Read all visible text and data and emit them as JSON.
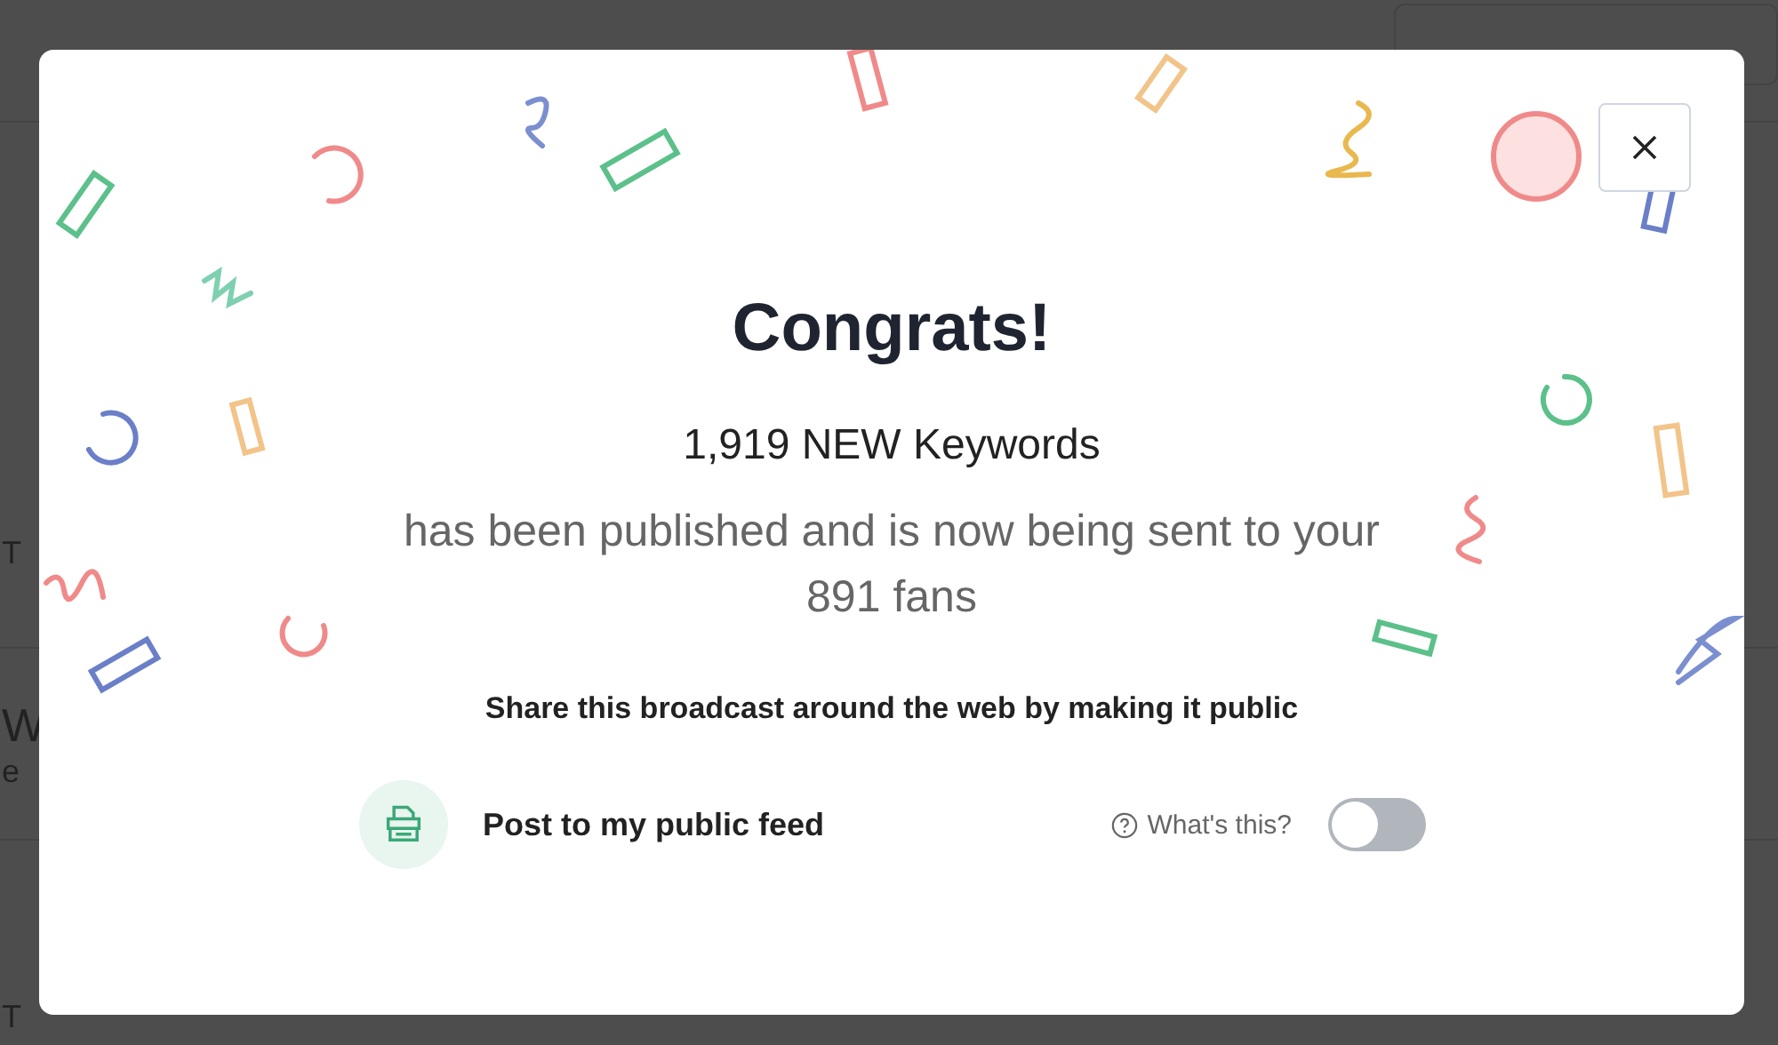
{
  "background": {
    "rows": [
      {
        "lines": [
          "T"
        ]
      },
      {
        "lines": [
          "W",
          "e"
        ]
      },
      {
        "lines": [
          "T"
        ]
      }
    ]
  },
  "modal": {
    "title": "Congrats!",
    "headline": "1,919 NEW Keywords",
    "message": "has been published and is now being sent to your 891 fans",
    "share_text": "Share this broadcast around the web by making it public",
    "feed": {
      "label": "Post to my public feed",
      "help": "What's this?",
      "on": false
    }
  }
}
